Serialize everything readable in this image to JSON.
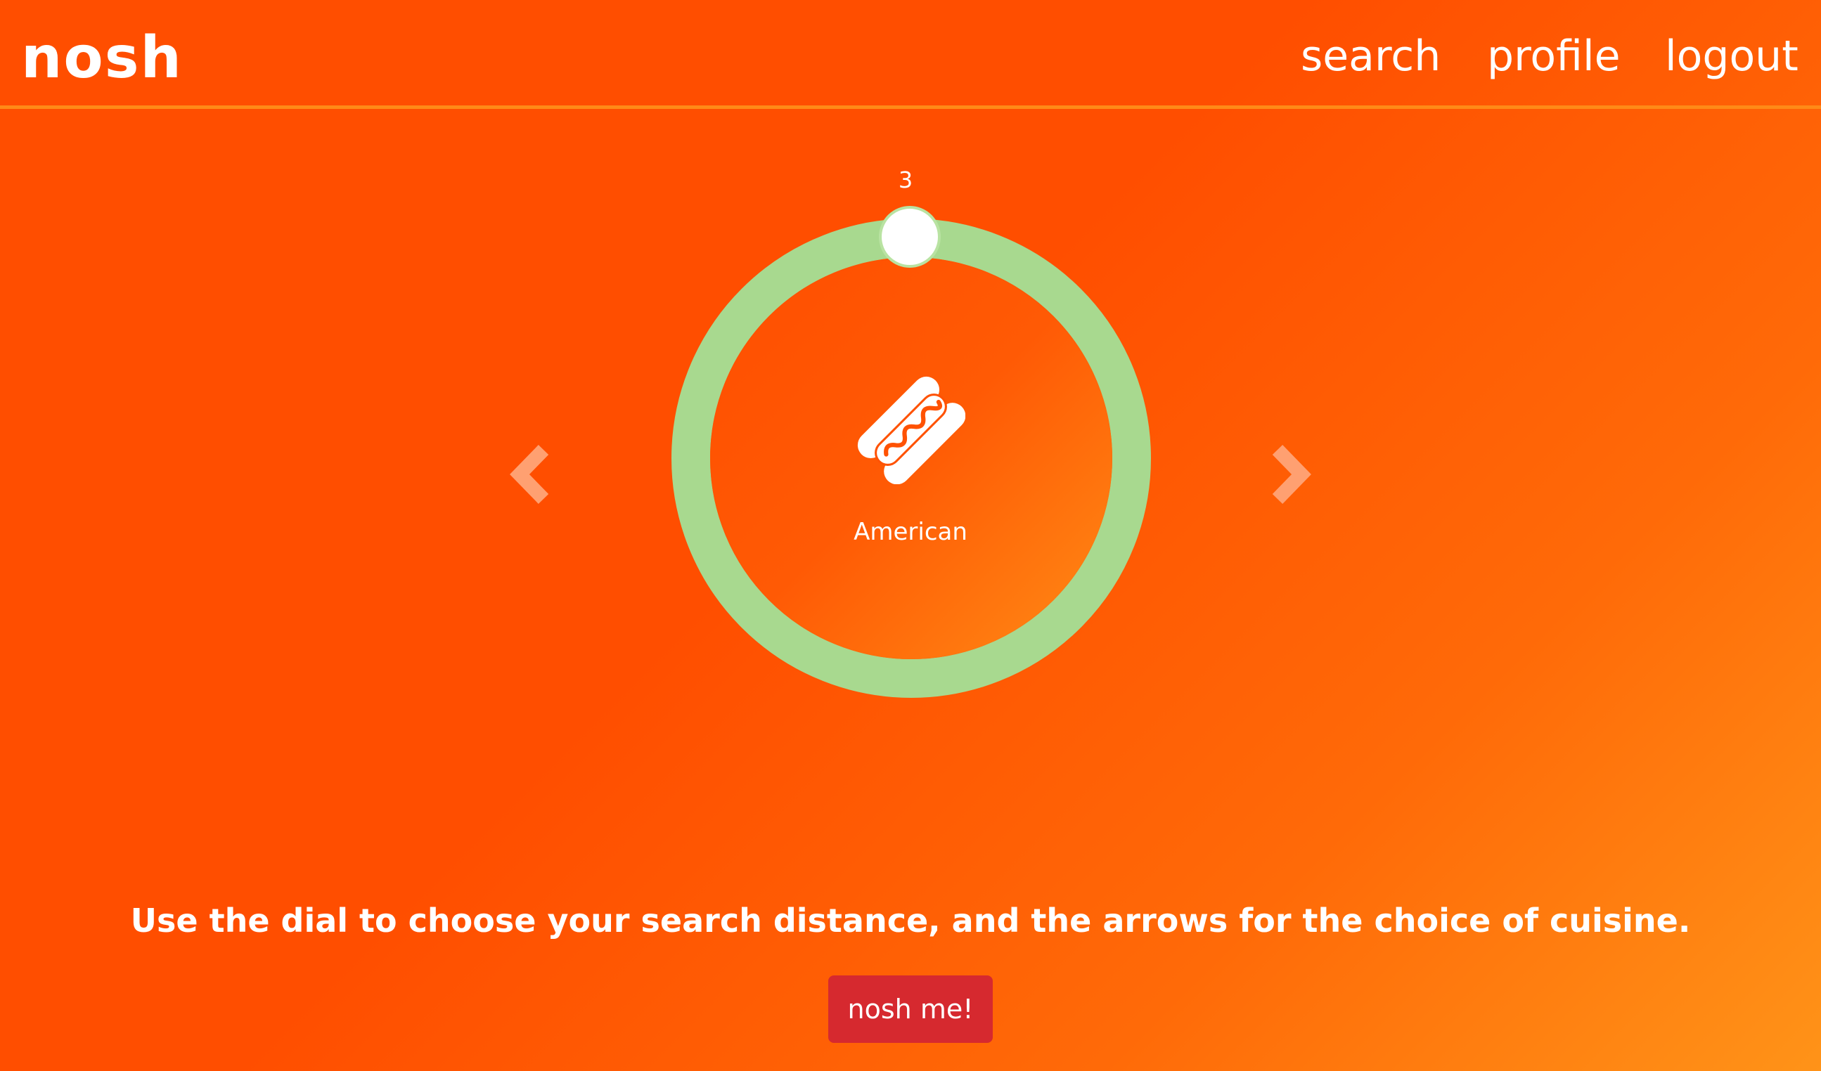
{
  "nav": {
    "brand": "nosh",
    "links": [
      "search",
      "profile",
      "logout"
    ]
  },
  "dial": {
    "distance_value": "3",
    "cuisine": "American",
    "cuisine_icon": "hotdog-icon",
    "ring_color": "#a8d98f",
    "handle_color": "#ffffff"
  },
  "arrows": {
    "prev_icon": "chevron-left-icon",
    "next_icon": "chevron-right-icon"
  },
  "instructions": "Use the dial to choose your search distance, and the arrows for the choice of cuisine.",
  "submit_label": "nosh me!",
  "colors": {
    "background_start": "#ff4e00",
    "background_end": "#ff9318",
    "nav_border": "#ff8a17",
    "button": "#d6292f"
  }
}
